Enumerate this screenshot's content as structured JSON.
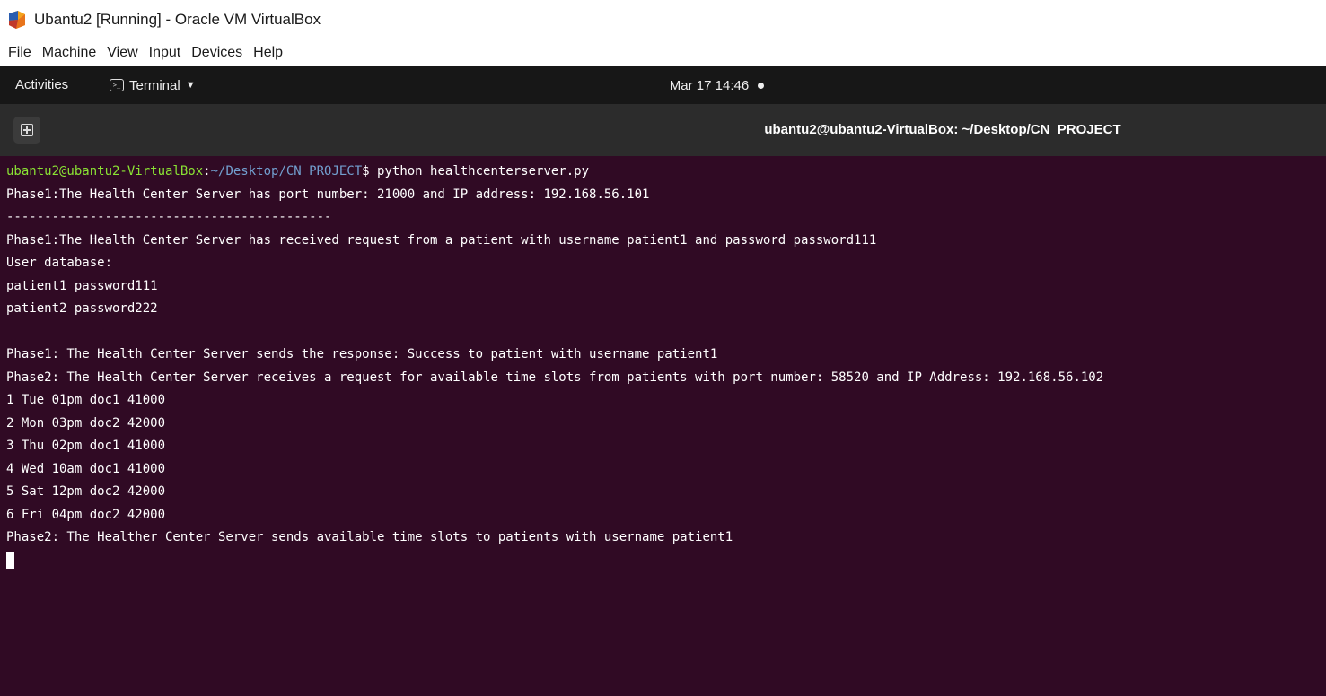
{
  "window": {
    "title": "Ubantu2 [Running] - Oracle VM VirtualBox"
  },
  "menubar": {
    "items": [
      "File",
      "Machine",
      "View",
      "Input",
      "Devices",
      "Help"
    ]
  },
  "topbar": {
    "activities": "Activities",
    "app_menu": "Terminal",
    "clock": "Mar 17  14:46"
  },
  "terminal": {
    "title": "ubantu2@ubantu2-VirtualBox: ~/Desktop/CN_PROJECT",
    "prompt": {
      "user_host": "ubantu2@ubantu2-VirtualBox",
      "separator": ":",
      "path": "~/Desktop/CN_PROJECT",
      "symbol": "$ ",
      "command": "python healthcenterserver.py"
    },
    "lines": [
      "Phase1:The Health Center Server has port number: 21000 and IP address: 192.168.56.101",
      "-------------------------------------------",
      "Phase1:The Health Center Server has received request from a patient with username patient1 and password password111",
      "User database:",
      "patient1 password111",
      "patient2 password222",
      "",
      "Phase1: The Health Center Server sends the response: Success to patient with username patient1",
      "Phase2: The Health Center Server receives a request for available time slots from patients with port number: 58520 and IP Address: 192.168.56.102",
      "1 Tue 01pm doc1 41000",
      "2 Mon 03pm doc2 42000",
      "3 Thu 02pm doc1 41000",
      "4 Wed 10am doc1 41000",
      "5 Sat 12pm doc2 42000",
      "6 Fri 04pm doc2 42000",
      "Phase2: The Healther Center Server sends available time slots to patients with username patient1"
    ]
  },
  "colors": {
    "terminal_bg": "#300a24",
    "prompt_user": "#8ae234",
    "prompt_path": "#729fcf",
    "topbar_bg": "#171717",
    "header_bg": "#2c2c2c"
  },
  "icons": {
    "app_icon": "virtualbox-icon",
    "terminal_icon": "terminal-icon",
    "dropdown": "caret-down-icon",
    "new_tab": "new-tab-icon",
    "status": "notification-dot-icon"
  }
}
